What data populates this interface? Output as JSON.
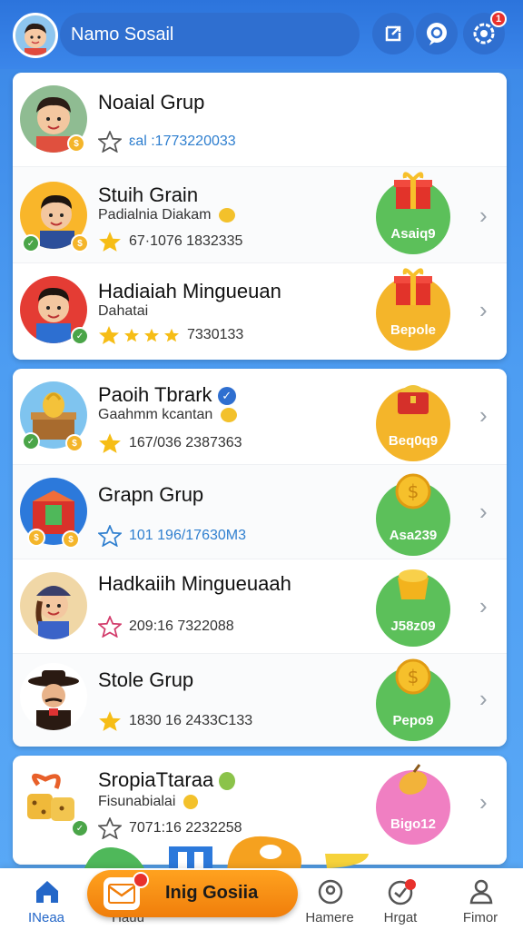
{
  "header": {
    "profile_name": "Namo Sosail",
    "notification_count": "1",
    "buttons": [
      "share-icon",
      "chat-icon",
      "settings-icon"
    ]
  },
  "groups": [
    {
      "title": "Noaial Grup",
      "subtitle": "",
      "stat": "ɛal :1773220033",
      "star": "outline-gray",
      "reward": null
    },
    {
      "title": "Stuih Grain",
      "subtitle": "Padialnia Diakam",
      "stat": "67·1076 1832335",
      "star": "gold",
      "reward": {
        "label": "Asaiq9",
        "color": "#5cc05a",
        "icon": "gift-icon"
      }
    },
    {
      "title": "Hadiaiah Mingueuan",
      "subtitle": "Dahatai",
      "stat": "7330133",
      "star": "gold-four",
      "reward": {
        "label": "Bepole",
        "color": "#f4b52a",
        "icon": "gift-icon"
      }
    },
    {
      "title": "Paoih Tbrark",
      "subtitle": "Gaahmm kcantan",
      "stat": "167/036 2387363",
      "star": "gold",
      "reward": {
        "label": "Beq0q9",
        "color": "#f4b52a",
        "icon": "chest-icon"
      }
    },
    {
      "title": "Grapn Grup",
      "subtitle": "",
      "stat": "101 196/17630M3",
      "star": "outline-blue",
      "reward": {
        "label": "Asa239",
        "color": "#5cc05a",
        "icon": "coin-icon"
      }
    },
    {
      "title": "Hadkaiih Mingueuaah",
      "subtitle": "",
      "stat": "209:16 7322088",
      "star": "outline-red",
      "reward": {
        "label": "J58z09",
        "color": "#5cc05a",
        "icon": "basket-icon"
      }
    },
    {
      "title": "Stole Grup",
      "subtitle": "",
      "stat": "1830 16 2433C133",
      "star": "gold",
      "reward": {
        "label": "Pepo9",
        "color": "#5cc05a",
        "icon": "coin-icon"
      }
    },
    {
      "title": "SropiaTtaraa",
      "subtitle": "Fisunabialai",
      "stat": "7071:16 2232258",
      "star": "outline-gray",
      "reward": {
        "label": "Bigo12",
        "color": "#f07fc2",
        "icon": "mango-icon"
      }
    }
  ],
  "bottom_nav": {
    "tabs": [
      {
        "label": "INeaa",
        "icon": "home-icon"
      },
      {
        "label": "Hauu",
        "icon": "mail-icon"
      },
      {
        "label": "Hamere",
        "icon": "profile-circle-icon"
      },
      {
        "label": "Hrgat",
        "icon": "gift-chat-icon"
      },
      {
        "label": "Fimor",
        "icon": "person-icon"
      }
    ],
    "center_button": "Inig Gosiia"
  }
}
